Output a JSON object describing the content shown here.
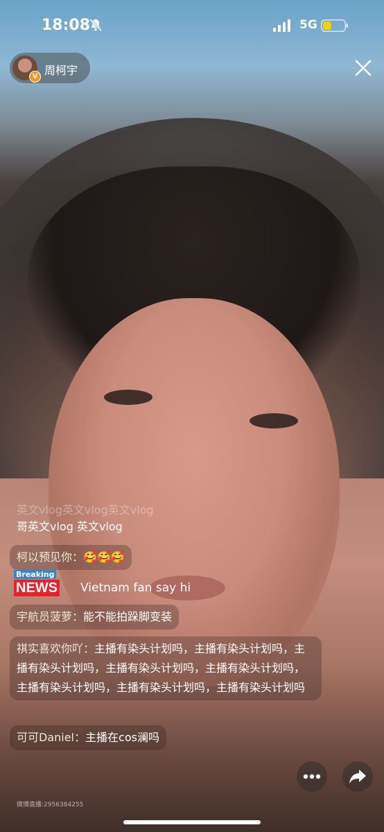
{
  "status_bar": {
    "time": "18:08",
    "network": "5G",
    "battery_color": "#f5d000"
  },
  "host": {
    "name": "周柯宇",
    "verified_badge": "V"
  },
  "comments": [
    {
      "user": "",
      "text": "英文vlog英文vlog英文vlog",
      "faded": true
    },
    {
      "user": "",
      "text": "哥英文vlog 英文vlog"
    },
    {
      "user": "柯以预见你：",
      "text": "🥰🥰🥰"
    },
    {
      "user": "",
      "text": "Vietnam fan say hi",
      "badge_top": "Breaking",
      "badge_main": "NEWS"
    },
    {
      "user": "宇航员菠萝：",
      "text": "能不能拍跺脚变装"
    },
    {
      "user": "祺实喜欢你吖：",
      "text": "主播有染头计划吗，主播有染头计划吗，主播有染头计划吗，主播有染头计划吗，主播有染头计划吗，主播有染头计划吗，主播有染头计划吗，主播有染头计划吗"
    },
    {
      "user": "可可Daniel：",
      "text": "主播在cos澜吗"
    }
  ],
  "watermark": "微博直播:2956384255",
  "icons": {
    "close": "close-icon",
    "more": "more-icon",
    "share": "share-icon",
    "mute": "bell-slash-icon"
  }
}
